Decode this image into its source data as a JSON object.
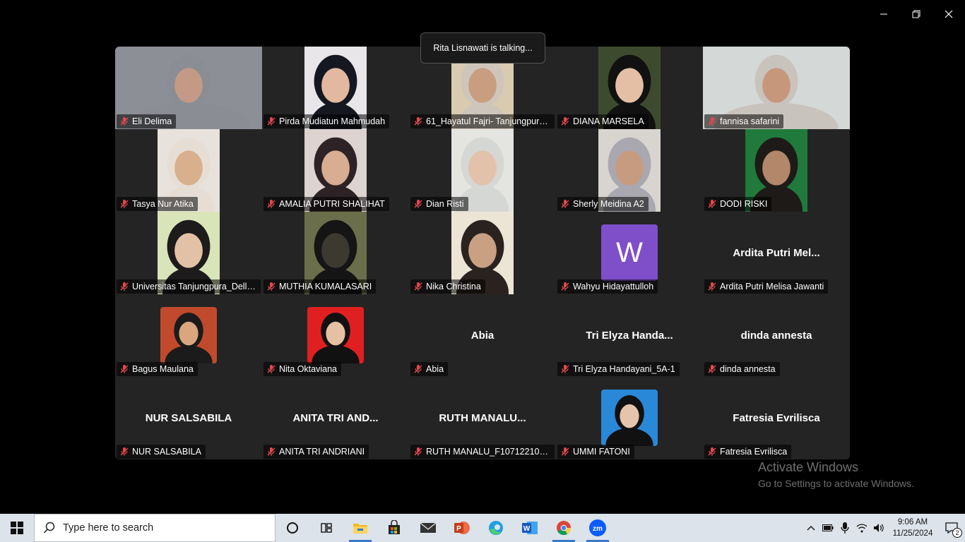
{
  "toast": {
    "text": "Rita Lisnawati is talking..."
  },
  "participants": [
    {
      "name": "Eli Delima",
      "video": "full",
      "bg": "#8d8f96",
      "skin": "#c49a86",
      "hijab": "#8a8d94"
    },
    {
      "name": "Pirda Mudiatun Mahmudah",
      "video": "narrow",
      "bg": "#e9e6ea",
      "skin": "#e2b9a0",
      "hijab": "#151820"
    },
    {
      "name": "61_Hayatul Fajri- Tanjungpura...",
      "video": "narrow",
      "bg": "#d9cbb0",
      "skin": "#c99e80",
      "hijab": "#cfc6bb"
    },
    {
      "name": "DIANA MARSELA",
      "video": "narrow",
      "bg": "#3e4a2e",
      "skin": "#e4bfa5",
      "hijab": "#111111"
    },
    {
      "name": "fannisa safarini",
      "video": "full",
      "bg": "#d4d8d6",
      "skin": "#c7977c",
      "hijab": "#c9c3bd"
    },
    {
      "name": "Tasya Nur Atika",
      "video": "narrow",
      "bg": "#e8e2dc",
      "skin": "#d8b08e",
      "hijab": "#e6ded5"
    },
    {
      "name": "AMALIA PUTRI SHALIHAT",
      "video": "narrow",
      "bg": "#ddd3d0",
      "skin": "#d9ad92",
      "hijab": "#2d2326"
    },
    {
      "name": "Dian Risti",
      "video": "narrow",
      "bg": "#e4e4e0",
      "skin": "#e2c2aa",
      "hijab": "#d5d7d4"
    },
    {
      "name": "Sherly Meidina A2",
      "video": "narrow",
      "bg": "#d8d4cf",
      "skin": "#c69b7f",
      "hijab": "#a9a8b0"
    },
    {
      "name": "DODI RISKI",
      "video": "narrow",
      "bg": "#1f7a3c",
      "skin": "#b2876a",
      "hijab": "#1e1a17"
    },
    {
      "name": "Universitas Tanjungpura_Della...",
      "video": "narrow",
      "bg": "#d9e5b9",
      "skin": "#e2c1a6",
      "hijab": "#1d1b1b"
    },
    {
      "name": "MUTHIA KUMALASARI",
      "video": "narrow",
      "bg": "#6b6e4a",
      "skin": "#3b3930",
      "hijab": "#151515"
    },
    {
      "name": "Nika Christina",
      "video": "narrow",
      "bg": "#ece5d6",
      "skin": "#caa083",
      "hijab": "#2a221e"
    },
    {
      "name": "Wahyu Hidayattulloh",
      "letter": "W"
    },
    {
      "name": "Ardita Putri Melisa Jawanti",
      "display": "Ardita Putri Mel..."
    },
    {
      "name": "Bagus Maulana",
      "photo": true,
      "bg": "#c24a2c",
      "skin": "#d9a67f",
      "hijab": "#1b1b1b"
    },
    {
      "name": "Nita Oktaviana",
      "photo": true,
      "bg": "#e02020",
      "skin": "#e6c0a3",
      "hijab": "#111111"
    },
    {
      "name": "Abia",
      "display": "Abia"
    },
    {
      "name": "Tri Elyza Handayani_5A-1",
      "display": "Tri  Elyza  Handa..."
    },
    {
      "name": "dinda annesta",
      "display": "dinda annesta"
    },
    {
      "name": "NUR SALSABILA",
      "display": "NUR SALSABILA"
    },
    {
      "name": "ANITA TRI ANDRIANI",
      "display": "ANITA TRI AND..."
    },
    {
      "name": "RUTH MANALU_F1071221051...",
      "display": "RUTH MANALU..."
    },
    {
      "name": "UMMI FATONI",
      "photo": true,
      "bg": "#2a88d8",
      "skin": "#e6c4ac",
      "hijab": "#111111"
    },
    {
      "name": "Fatresia Evrilisca",
      "display": "Fatresia Evrilisca"
    }
  ],
  "watermark": {
    "title": "Activate Windows",
    "subtitle": "Go to Settings to activate Windows."
  },
  "taskbar": {
    "search_placeholder": "Type here to search",
    "time": "9:06 AM",
    "date": "11/25/2024",
    "notification_count": "2"
  }
}
